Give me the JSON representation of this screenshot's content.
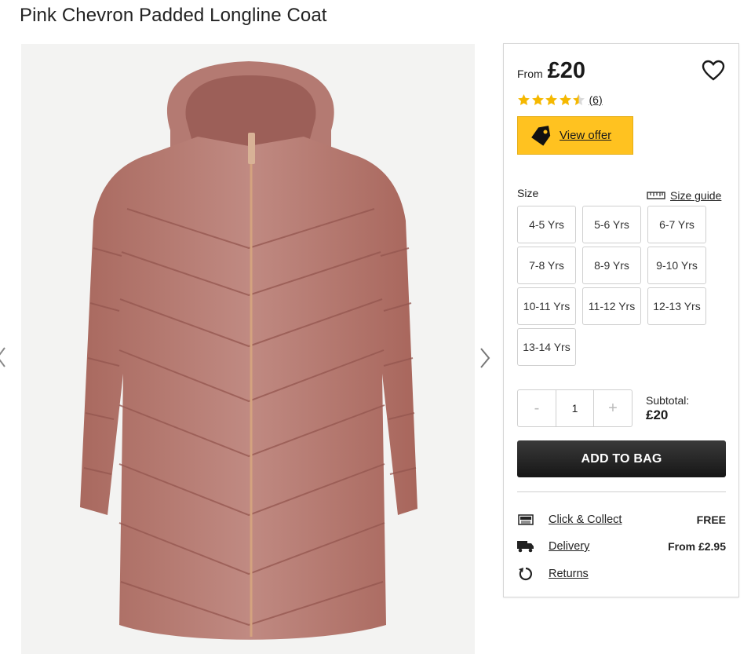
{
  "product": {
    "title": "Pink Chevron Padded Longline Coat"
  },
  "pricing": {
    "from_label": "From",
    "price": "£20"
  },
  "rating": {
    "stars": 4.5,
    "count_label": "(6)"
  },
  "offer": {
    "label": "View offer"
  },
  "size_section": {
    "label": "Size",
    "guide_label": "Size guide",
    "options": [
      "4-5 Yrs",
      "5-6 Yrs",
      "6-7 Yrs",
      "7-8 Yrs",
      "8-9 Yrs",
      "9-10 Yrs",
      "10-11 Yrs",
      "11-12 Yrs",
      "12-13 Yrs",
      "13-14 Yrs"
    ]
  },
  "quantity": {
    "minus": "-",
    "value": "1",
    "plus": "+"
  },
  "subtotal": {
    "label": "Subtotal:",
    "amount": "£20"
  },
  "cart": {
    "add_label": "ADD TO BAG"
  },
  "services": [
    {
      "label": "Click & Collect",
      "value": "FREE",
      "icon": "store-icon"
    },
    {
      "label": "Delivery",
      "value": "From £2.95",
      "icon": "truck-icon"
    },
    {
      "label": "Returns",
      "value": "",
      "icon": "returns-icon"
    }
  ],
  "colors": {
    "offer_bg": "#ffc220",
    "star": "#f5b800",
    "coat": "#b77a72",
    "button_dark": "#1e1e1e"
  }
}
